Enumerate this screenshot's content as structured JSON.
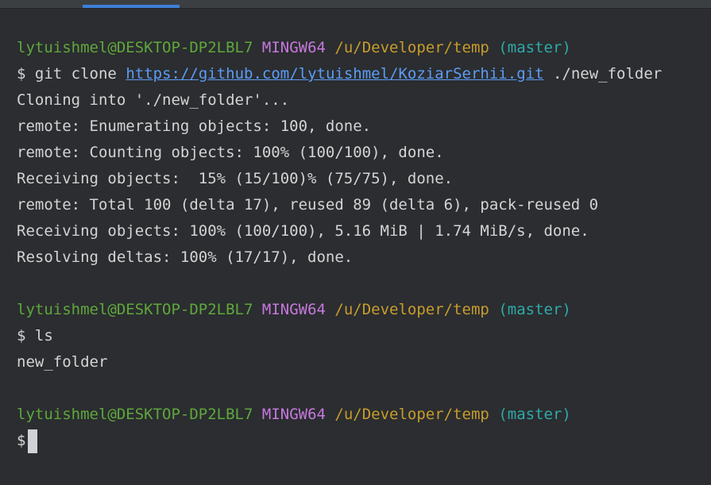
{
  "prompt": {
    "user_host": "lytuishmel@DESKTOP-DP2LBL7",
    "shell": "MINGW64",
    "path": "/u/Developer/temp",
    "branch": "(master)",
    "symbol": "$"
  },
  "commands": {
    "clone_cmd": "git clone",
    "clone_url": "https://github.com/lytuishmel/KoziarSerhii.git",
    "clone_dest": "./new_folder",
    "ls_cmd": "ls"
  },
  "clone_output": [
    "Cloning into './new_folder'...",
    "remote: Enumerating objects: 100, done.",
    "remote: Counting objects: 100% (100/100), done.",
    "Receiving objects:  15% (15/100)% (75/75), done.",
    "remote: Total 100 (delta 17), reused 89 (delta 6), pack-reused 0",
    "Receiving objects: 100% (100/100), 5.16 MiB | 1.74 MiB/s, done.",
    "Resolving deltas: 100% (17/17), done."
  ],
  "ls_output": [
    "new_folder"
  ],
  "colors": {
    "background": "#2b2d30",
    "user": "#5fa73c",
    "host": "#c678dd",
    "path": "#c79c2c",
    "branch": "#2ea9a8",
    "link": "#5c9cf5",
    "tab_indicator": "#3d7fd6"
  }
}
